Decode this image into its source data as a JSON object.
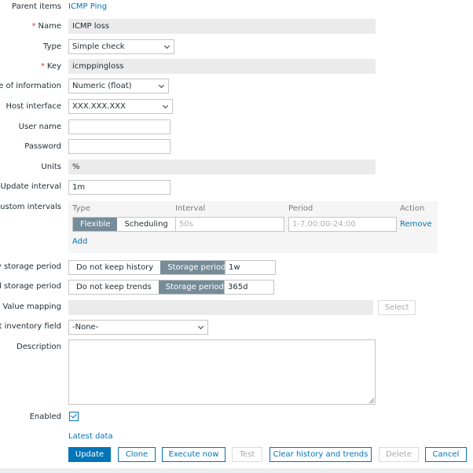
{
  "form": {
    "parent_items": {
      "label": "Parent items",
      "value": "ICMP Ping"
    },
    "name": {
      "label": "Name",
      "value": "ICMP loss"
    },
    "type": {
      "label": "Type",
      "value": "Simple check"
    },
    "key": {
      "label": "Key",
      "value": "icmppingloss"
    },
    "type_of_information": {
      "label": "ype of information",
      "value": "Numeric (float)"
    },
    "host_interface": {
      "label": "Host interface",
      "value": "XXX.XXX.XXX"
    },
    "user_name": {
      "label": "User name",
      "value": ""
    },
    "password": {
      "label": "Password",
      "value": ""
    },
    "units": {
      "label": "Units",
      "value": "%"
    },
    "update_interval": {
      "label": "Update interval",
      "value": "1m"
    },
    "custom_intervals": {
      "label": "Custom intervals",
      "headers": {
        "type": "Type",
        "interval": "Interval",
        "period": "Period",
        "action": "Action"
      },
      "row": {
        "type_options": [
          "Flexible",
          "Scheduling"
        ],
        "selected": "Flexible",
        "interval_placeholder": "50s",
        "period_placeholder": "1-7,00:00-24:00",
        "remove": "Remove"
      },
      "add": "Add"
    },
    "history": {
      "label": "ry storage period",
      "options": [
        "Do not keep history",
        "Storage period"
      ],
      "selected": "Storage period",
      "value": "1w"
    },
    "trends": {
      "label": "nd storage period",
      "options": [
        "Do not keep trends",
        "Storage period"
      ],
      "selected": "Storage period",
      "value": "365d"
    },
    "value_mapping": {
      "label": "Value mapping",
      "value": "",
      "select_button": "Select"
    },
    "inventory_field": {
      "label": "ost inventory field",
      "value": "-None-"
    },
    "description": {
      "label": "Description",
      "value": ""
    },
    "enabled": {
      "label": "Enabled",
      "checked": true
    },
    "latest_data": "Latest data"
  },
  "buttons": {
    "update": "Update",
    "clone": "Clone",
    "execute_now": "Execute now",
    "test": "Test",
    "clear_history": "Clear history and trends",
    "delete": "Delete",
    "cancel": "Cancel"
  },
  "required_marker": "*"
}
